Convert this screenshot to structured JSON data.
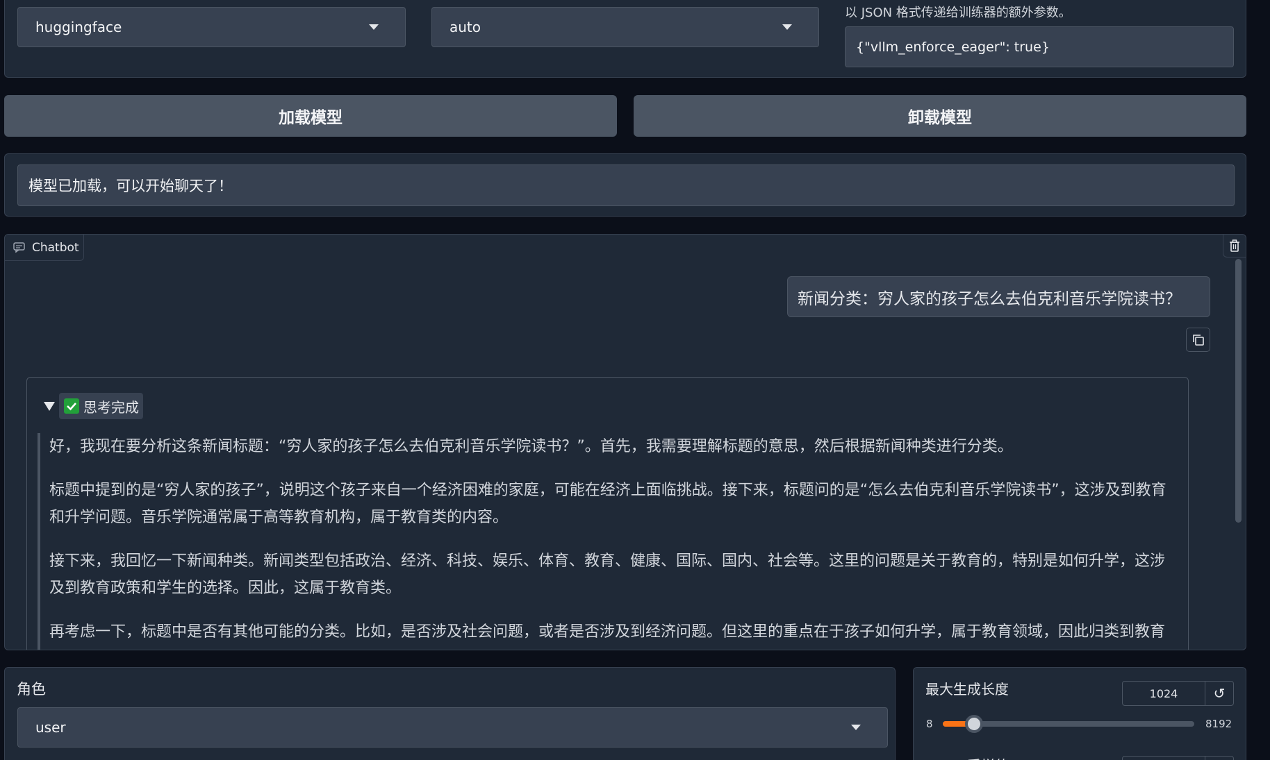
{
  "top_row": {
    "infer_backend": "huggingface",
    "infer_dtype": "auto",
    "extra_args_hint": "以 JSON 格式传递给训练器的额外参数。",
    "extra_args_value": "{\"vllm_enforce_eager\": true}"
  },
  "buttons": {
    "load_model": "加载模型",
    "unload_model": "卸载模型"
  },
  "status": {
    "info": "模型已加载，可以开始聊天了！"
  },
  "chatbot": {
    "tab_label": "Chatbot",
    "user_message": "新闻分类：穷人家的孩子怎么去伯克利音乐学院读书？",
    "thinking_label": "思考完成",
    "thinking_paragraphs": [
      "好，我现在要分析这条新闻标题：“穷人家的孩子怎么去伯克利音乐学院读书？”。首先，我需要理解标题的意思，然后根据新闻种类进行分类。",
      "标题中提到的是“穷人家的孩子”，说明这个孩子来自一个经济困难的家庭，可能在经济上面临挑战。接下来，标题问的是“怎么去伯克利音乐学院读书”，这涉及到教育和升学问题。音乐学院通常属于高等教育机构，属于教育类的内容。",
      "接下来，我回忆一下新闻种类。新闻类型包括政治、经济、科技、娱乐、体育、教育、健康、国际、国内、社会等。这里的问题是关于教育的，特别是如何升学，这涉及到教育政策和学生的选择。因此，这属于教育类。",
      "再考虑一下，标题中是否有其他可能的分类。比如，是否涉及社会问题，或者是否涉及到经济问题。但这里的重点在于孩子如何升学，属于教育领域，因此归类到教育类比较合适。"
    ]
  },
  "role": {
    "label": "角色",
    "value": "user"
  },
  "max_new_tokens": {
    "label": "最大生成长度",
    "value": "1024",
    "min": "8",
    "max": "8192",
    "current": 1024
  },
  "top_p": {
    "label": "Top-p 采样值"
  },
  "colors": {
    "accent": "#f97316",
    "panel": "#1f2937",
    "field": "#374151",
    "background": "#0b0f19"
  },
  "icons": {
    "dropdown": "chevron-down-icon",
    "chat": "chat-bubble-icon",
    "trash": "trash-icon",
    "copy": "copy-icon",
    "check": "check-box-icon",
    "reset": "reset-icon"
  }
}
